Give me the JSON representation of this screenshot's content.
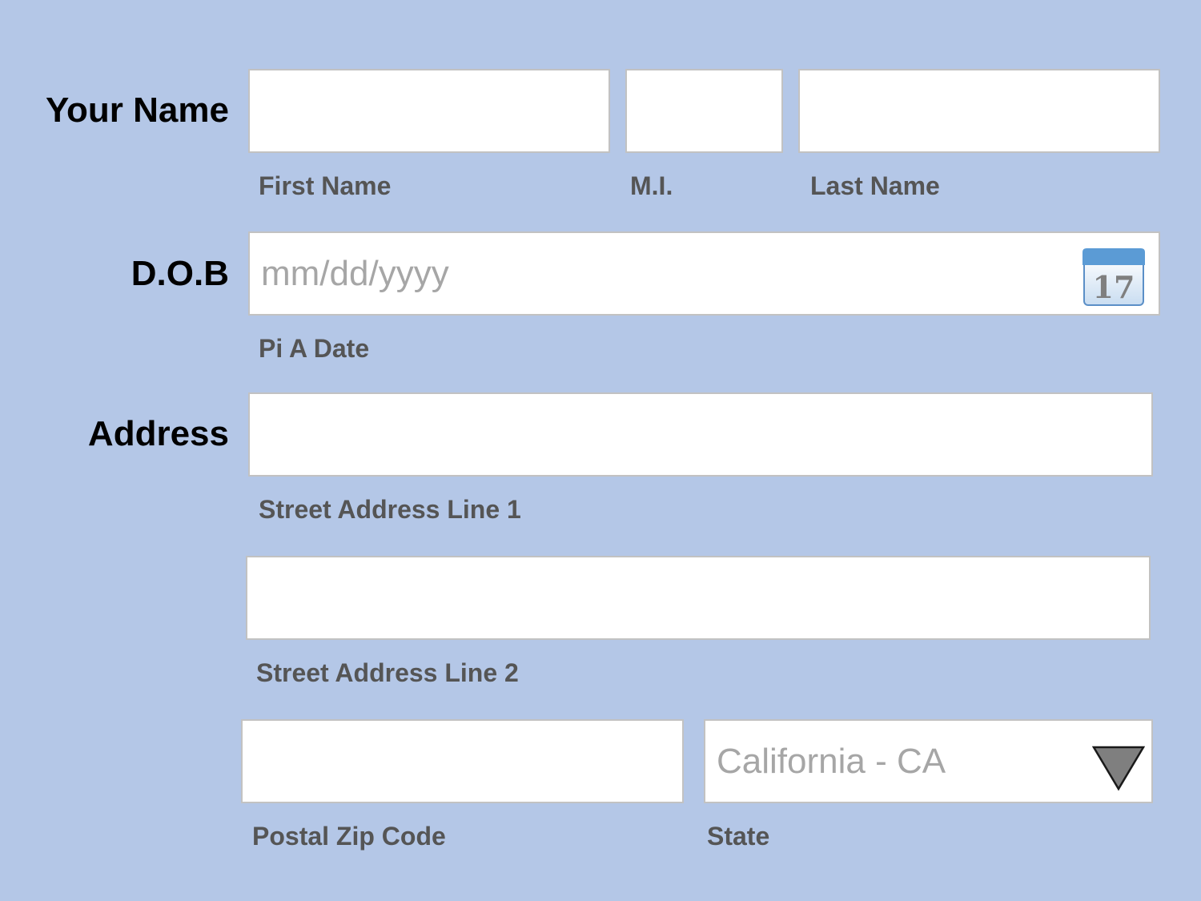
{
  "form": {
    "name": {
      "label": "Your Name",
      "first_label": "First Name",
      "mi_label": "M.I.",
      "last_label": "Last Name",
      "first_value": "",
      "mi_value": "",
      "last_value": ""
    },
    "dob": {
      "label": "D.O.B",
      "placeholder": "mm/dd/yyyy",
      "value": "",
      "sub_label": "Pi A Date",
      "calendar_day": "17",
      "calendar_icon": "calendar-icon"
    },
    "address": {
      "label": "Address",
      "line1_label": "Street Address Line 1",
      "line2_label": "Street Address Line 2",
      "zip_label": "Postal Zip Code",
      "state_label": "State",
      "state_value": "California - CA",
      "line1_value": "",
      "line2_value": "",
      "zip_value": "",
      "dropdown_icon": "triangle-down-icon"
    }
  },
  "colors": {
    "background": "#b4c7e7",
    "field_border": "#c2c2c2",
    "sub_label": "#555555",
    "placeholder": "#a6a6a6",
    "calendar_header": "#5b9bd5"
  }
}
